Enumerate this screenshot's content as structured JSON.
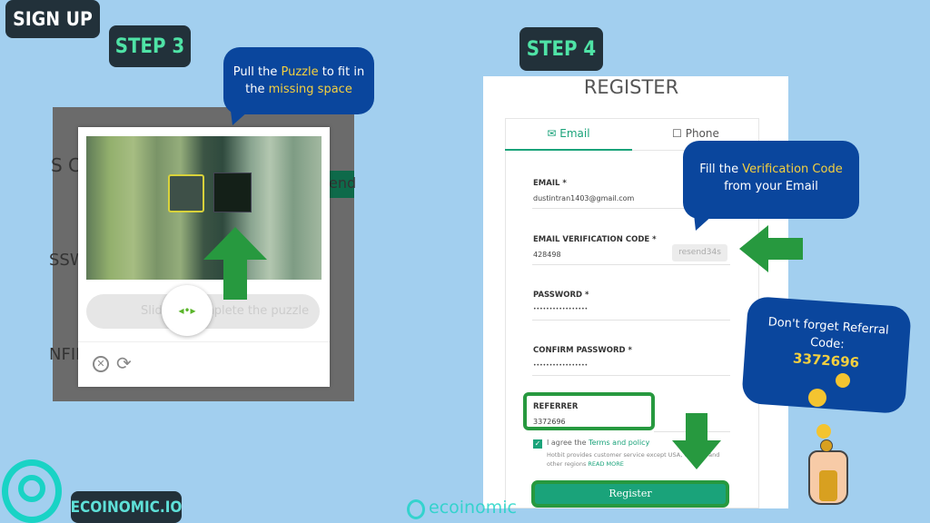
{
  "header": {
    "sign_up": "SIGN UP",
    "step3": "STEP 3",
    "step4": "STEP 4"
  },
  "captcha": {
    "bubble_pre": "Pull the ",
    "bubble_hl1": "Puzzle",
    "bubble_mid": " to fit in the ",
    "bubble_hl2": "missing space",
    "slider_text": "Slide to complete the puzzle",
    "bg_fragments": [
      "S CO",
      "SSW",
      "NFIR",
      "end"
    ]
  },
  "register": {
    "title": "REGISTER",
    "tabs": [
      {
        "label": "Email",
        "active": true
      },
      {
        "label": "Phone",
        "active": false
      }
    ],
    "fields": [
      {
        "label": "EMAIL *",
        "value": "dustintran1403@gmail.com"
      },
      {
        "label": "EMAIL VERIFICATION CODE *",
        "value": "428498",
        "button": "resend34s"
      },
      {
        "label": "PASSWORD *",
        "value": "•••••••••••••••••"
      },
      {
        "label": "CONFIRM PASSWORD *",
        "value": "•••••••••••••••••"
      },
      {
        "label": "REFERRER",
        "value": "3372696"
      }
    ],
    "agree_pre": "I agree the ",
    "agree_link": "Terms and policy",
    "notice": "Hotbit provides customer service except USA, Canada and other regions ",
    "read_more": "READ MORE",
    "agreed": true,
    "submit": "Register"
  },
  "bubbles": {
    "verify_pre": "Fill the ",
    "verify_hl": "Verification Code",
    "verify_post": " from your Email",
    "referral_text": "Don't forget Referral Code:",
    "referral_code": "3372696"
  },
  "branding": {
    "logo_text": "ECOINOMIC.IO",
    "watermark": "ecoinomic"
  },
  "colors": {
    "background": "#a2cfef",
    "bubble": "#0a469d",
    "arrow": "#27993f",
    "accent": "#1aa37a",
    "highlight": "#f4d03f"
  }
}
